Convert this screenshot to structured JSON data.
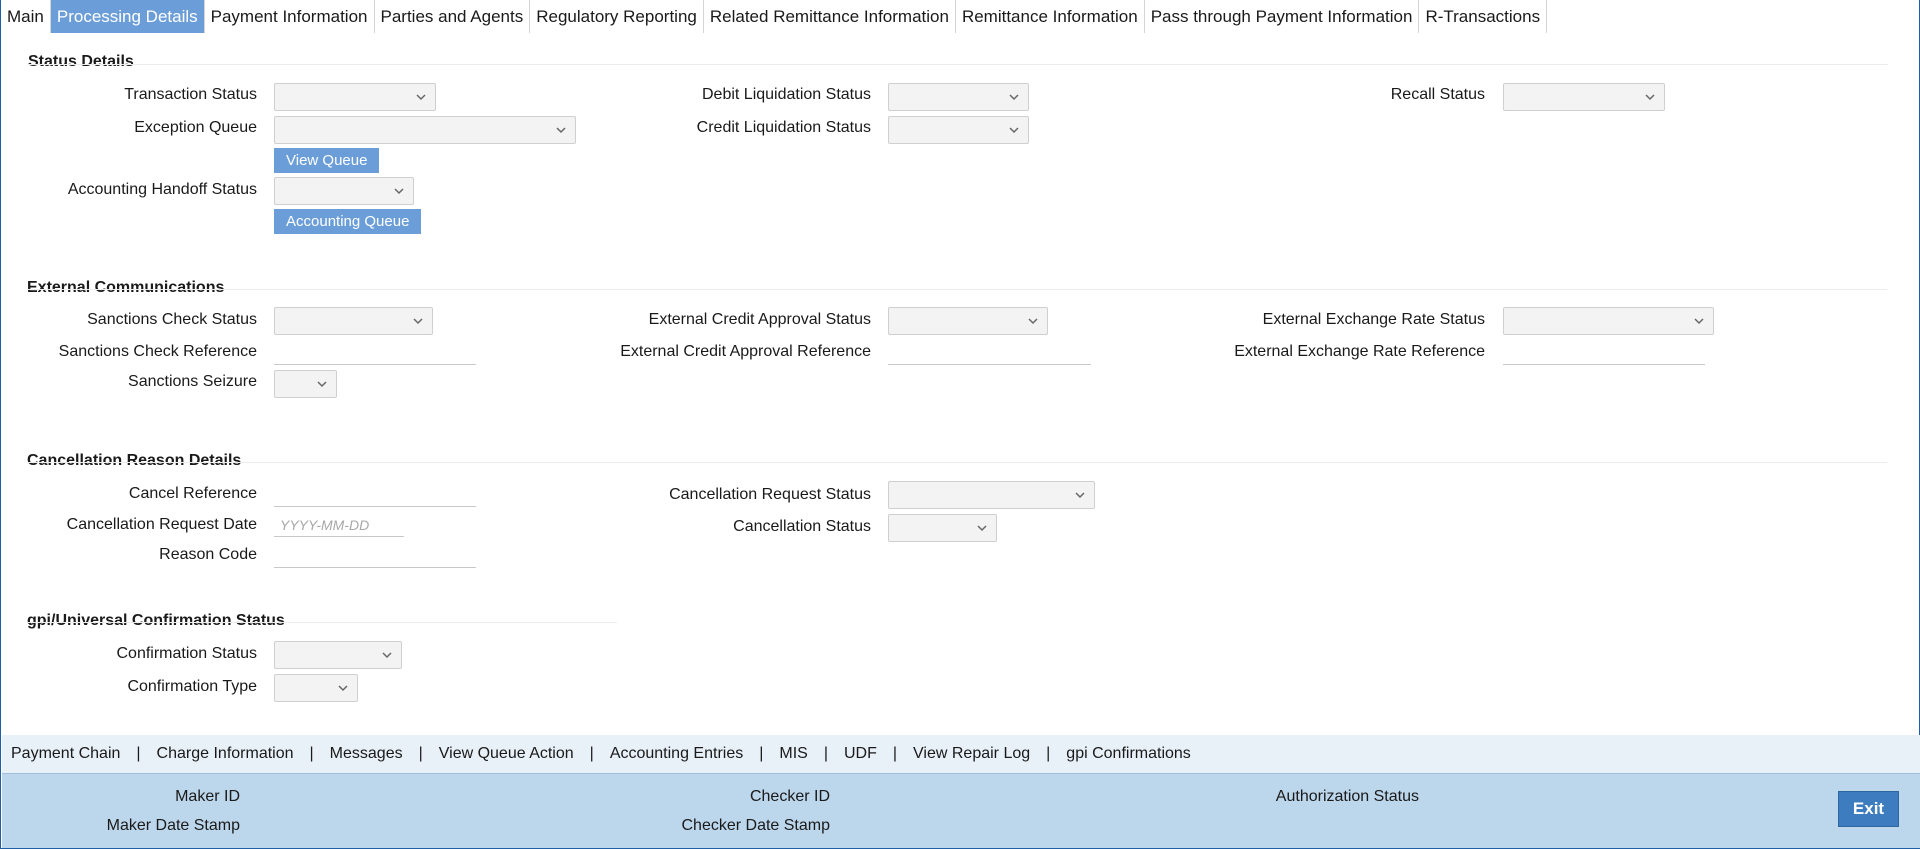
{
  "tabs": [
    {
      "label": "Main",
      "active": false
    },
    {
      "label": "Processing Details",
      "active": true
    },
    {
      "label": "Payment Information",
      "active": false
    },
    {
      "label": "Parties and Agents",
      "active": false
    },
    {
      "label": "Regulatory Reporting",
      "active": false
    },
    {
      "label": "Related Remittance Information",
      "active": false
    },
    {
      "label": "Remittance Information",
      "active": false
    },
    {
      "label": "Pass through Payment Information",
      "active": false
    },
    {
      "label": "R-Transactions",
      "active": false
    }
  ],
  "status_details": {
    "title": "Status Details",
    "transaction_status": "Transaction Status",
    "exception_queue": "Exception Queue",
    "view_queue": "View Queue",
    "accounting_handoff_status": "Accounting Handoff Status",
    "accounting_queue": "Accounting Queue",
    "debit_liquidation_status": "Debit Liquidation Status",
    "credit_liquidation_status": "Credit Liquidation Status",
    "recall_status": "Recall Status"
  },
  "external_communications": {
    "title": "External Communications",
    "sanctions_check_status": "Sanctions Check Status",
    "sanctions_check_reference": "Sanctions Check Reference",
    "sanctions_seizure": "Sanctions Seizure",
    "external_credit_approval_status": "External Credit Approval Status",
    "external_credit_approval_reference": "External Credit Approval Reference",
    "external_exchange_rate_status": "External Exchange Rate Status",
    "external_exchange_rate_reference": "External Exchange Rate Reference"
  },
  "cancellation": {
    "title": "Cancellation Reason Details",
    "cancel_reference": "Cancel Reference",
    "cancellation_request_date": "Cancellation Request Date",
    "date_placeholder": "YYYY-MM-DD",
    "reason_code": "Reason Code",
    "cancellation_request_status": "Cancellation Request Status",
    "cancellation_status": "Cancellation Status"
  },
  "gpi": {
    "title": "gpi/Universal Confirmation Status",
    "confirmation_status": "Confirmation Status",
    "confirmation_type": "Confirmation Type"
  },
  "footer_nav": [
    "Payment Chain",
    "Charge Information",
    "Messages",
    "View Queue Action",
    "Accounting Entries",
    "MIS",
    "UDF",
    "View Repair Log",
    "gpi Confirmations"
  ],
  "footer_separator": "|",
  "audit": {
    "maker_id": "Maker ID",
    "maker_date_stamp": "Maker Date Stamp",
    "checker_id": "Checker ID",
    "checker_date_stamp": "Checker Date Stamp",
    "authorization_status": "Authorization Status",
    "exit": "Exit"
  },
  "colors": {
    "active_tab": "#6b9ed8",
    "button": "#6b9ed8",
    "audit_bg": "#bcd6ec",
    "exit_button": "#3d7dbf"
  }
}
